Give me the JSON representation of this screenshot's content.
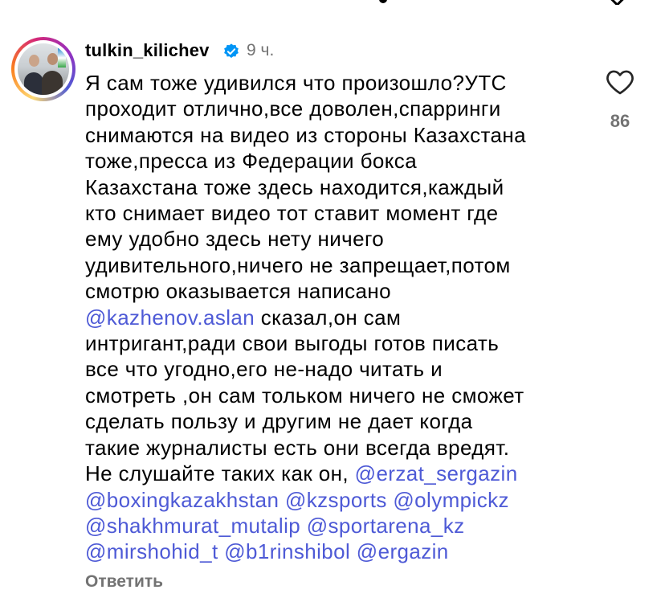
{
  "comment": {
    "username": "tulkin_kilichev",
    "time_ago": "9 ч.",
    "lines": [
      {
        "segments": [
          {
            "text": "Я сам тоже удивился что произошло?УТС",
            "mention": false
          }
        ]
      },
      {
        "segments": [
          {
            "text": "проходит отлично,все доволен,спарринги",
            "mention": false
          }
        ]
      },
      {
        "segments": [
          {
            "text": "снимаются на видео из стороны Казахстана",
            "mention": false
          }
        ]
      },
      {
        "segments": [
          {
            "text": "тоже,пресса из Федерации бокса",
            "mention": false
          }
        ]
      },
      {
        "segments": [
          {
            "text": "Казахстана тоже здесь находится,каждый",
            "mention": false
          }
        ]
      },
      {
        "segments": [
          {
            "text": "кто снимает видео тот ставит момент где",
            "mention": false
          }
        ]
      },
      {
        "segments": [
          {
            "text": "ему удобно здесь нету ничего",
            "mention": false
          }
        ]
      },
      {
        "segments": [
          {
            "text": "удивительного,ничего не запрещает,потом",
            "mention": false
          }
        ]
      },
      {
        "segments": [
          {
            "text": "смотрю оказывается написано",
            "mention": false
          }
        ]
      },
      {
        "segments": [
          {
            "text": "@kazhenov.aslan",
            "mention": true
          },
          {
            "text": " сказал,он сам",
            "mention": false
          }
        ]
      },
      {
        "segments": [
          {
            "text": "интригант,ради свои выгоды готов писать",
            "mention": false
          }
        ]
      },
      {
        "segments": [
          {
            "text": "все что угодно,его не-надо читать и",
            "mention": false
          }
        ]
      },
      {
        "segments": [
          {
            "text": "смотреть ,он сам тольком ничего не сможет",
            "mention": false
          }
        ]
      },
      {
        "segments": [
          {
            "text": "сделать пользу и другим не дает когда",
            "mention": false
          }
        ]
      },
      {
        "segments": [
          {
            "text": "такие журналисты есть они всегда вредят.",
            "mention": false
          }
        ]
      },
      {
        "segments": [
          {
            "text": "Не слушайте таких как он, ",
            "mention": false
          },
          {
            "text": "@erzat_sergazin",
            "mention": true
          }
        ]
      },
      {
        "segments": [
          {
            "text": "@boxingkazakhstan",
            "mention": true
          },
          {
            "text": " ",
            "mention": false
          },
          {
            "text": "@kzsports",
            "mention": true
          },
          {
            "text": " ",
            "mention": false
          },
          {
            "text": "@olympickz",
            "mention": true
          }
        ]
      },
      {
        "segments": [
          {
            "text": "@shakhmurat_mutalip",
            "mention": true
          },
          {
            "text": " ",
            "mention": false
          },
          {
            "text": "@sportarena_kz",
            "mention": true
          }
        ]
      },
      {
        "segments": [
          {
            "text": "@mirshohid_t",
            "mention": true
          },
          {
            "text": " ",
            "mention": false
          },
          {
            "text": "@b1rinshibol",
            "mention": true
          },
          {
            "text": " ",
            "mention": false
          },
          {
            "text": "@ergazin",
            "mention": true
          }
        ]
      }
    ],
    "like_count": "86",
    "reply_label": "Ответить",
    "icons": {
      "avatar": "profile-photo",
      "verified": "verified-badge-icon",
      "like": "heart-outline-icon"
    },
    "colors": {
      "mention": "#4e5ad6",
      "muted": "#737373",
      "verified": "#0095f6",
      "text": "#000000"
    }
  }
}
